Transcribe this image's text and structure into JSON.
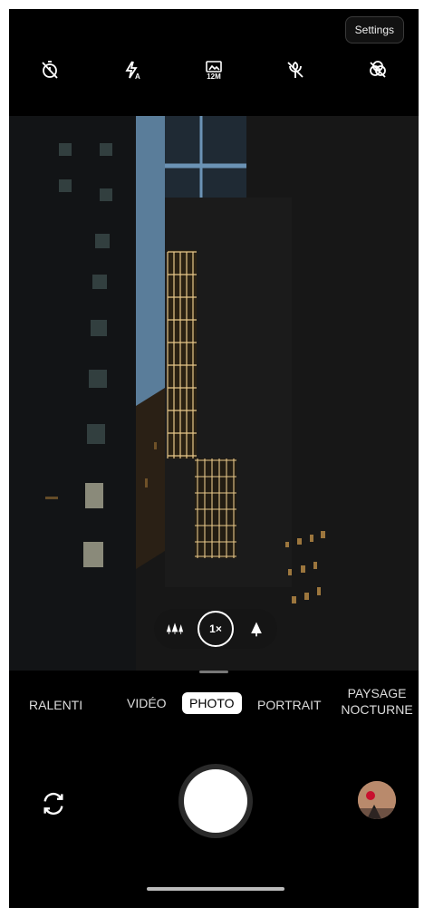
{
  "settings_label": "Settings",
  "top_icons": [
    "timer-off-icon",
    "flash-auto-icon",
    "resolution-12m-icon",
    "macro-off-icon",
    "filter-off-icon"
  ],
  "resolution_label": "12M",
  "zoom": {
    "current_label": "1×",
    "wide_icon": "trees-wide-icon",
    "tele_icon": "tree-tele-icon"
  },
  "modes": {
    "ralenti": "RALENTI",
    "video": "VIDÉO",
    "photo": "PHOTO",
    "portrait": "PORTRAIT",
    "night_line1": "PAYSAGE",
    "night_line2": "NOCTURNE",
    "active": "PHOTO"
  },
  "colors": {
    "background": "#000000",
    "shutter": "#ffffff",
    "active_mode_bg": "#ffffff"
  }
}
